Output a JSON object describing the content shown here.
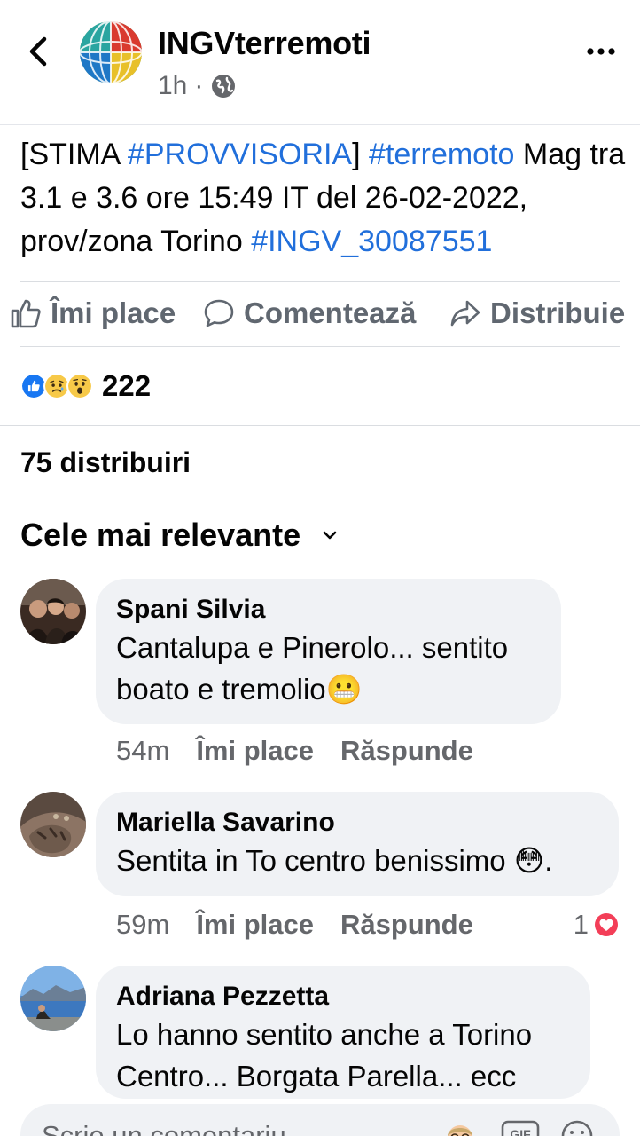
{
  "post": {
    "page_name": "INGVterremoti",
    "time": "1h",
    "separator": "·",
    "text_parts": [
      {
        "t": "[STIMA ",
        "tag": false
      },
      {
        "t": "#PROVVISORIA",
        "tag": true
      },
      {
        "t": "] ",
        "tag": false
      },
      {
        "t": "#terremoto",
        "tag": true
      },
      {
        "t": " Mag tra 3.1 e 3.6 ore 15:49 IT del 26-02-2022, prov/zona Torino ",
        "tag": false
      },
      {
        "t": "#INGV_30087551",
        "tag": true
      }
    ]
  },
  "actions": {
    "like": "Îmi place",
    "comment": "Comentează",
    "share": "Distribuie"
  },
  "reactions": {
    "icons": [
      "like-icon",
      "sad-icon",
      "wow-icon"
    ],
    "count": "222"
  },
  "shares": "75 distribuiri",
  "sort_label": "Cele mai relevante",
  "comments": [
    {
      "name": "Spani Silvia",
      "text": "Cantalupa e Pinerolo... sentito boato e tremolio😬",
      "time": "54m",
      "like": "Îmi place",
      "reply": "Răspunde"
    },
    {
      "name": "Mariella Savarino",
      "text": "Sentita in To centro benissimo 😳.",
      "time": "59m",
      "like": "Îmi place",
      "reply": "Răspunde",
      "likes": "1"
    },
    {
      "name": "Adriana Pezzetta",
      "text": "Lo hanno sentito anche a Torino Centro... Borgata Parella... ecc"
    }
  ],
  "composer": {
    "placeholder": "Scrie un comentariu..."
  },
  "colors": {
    "hashtag": "#216fdb",
    "secondary_text": "#65676b",
    "bubble": "#f0f2f5",
    "like_blue": "#1877f2",
    "heart_red": "#f33e58"
  }
}
